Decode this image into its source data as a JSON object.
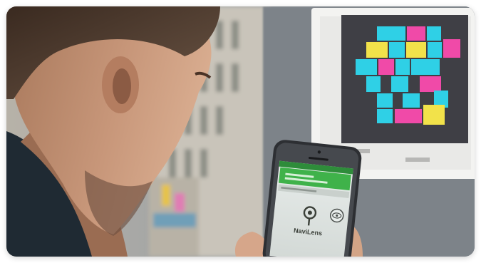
{
  "photo": {
    "subject": "person-using-smartphone",
    "poster_colors": [
      "#2fd0e6",
      "#f04aa8",
      "#f2e24a",
      "#3f3f45"
    ],
    "phone_app": {
      "brand_label": "NaviLens",
      "header_color": "#3fb24a"
    }
  }
}
